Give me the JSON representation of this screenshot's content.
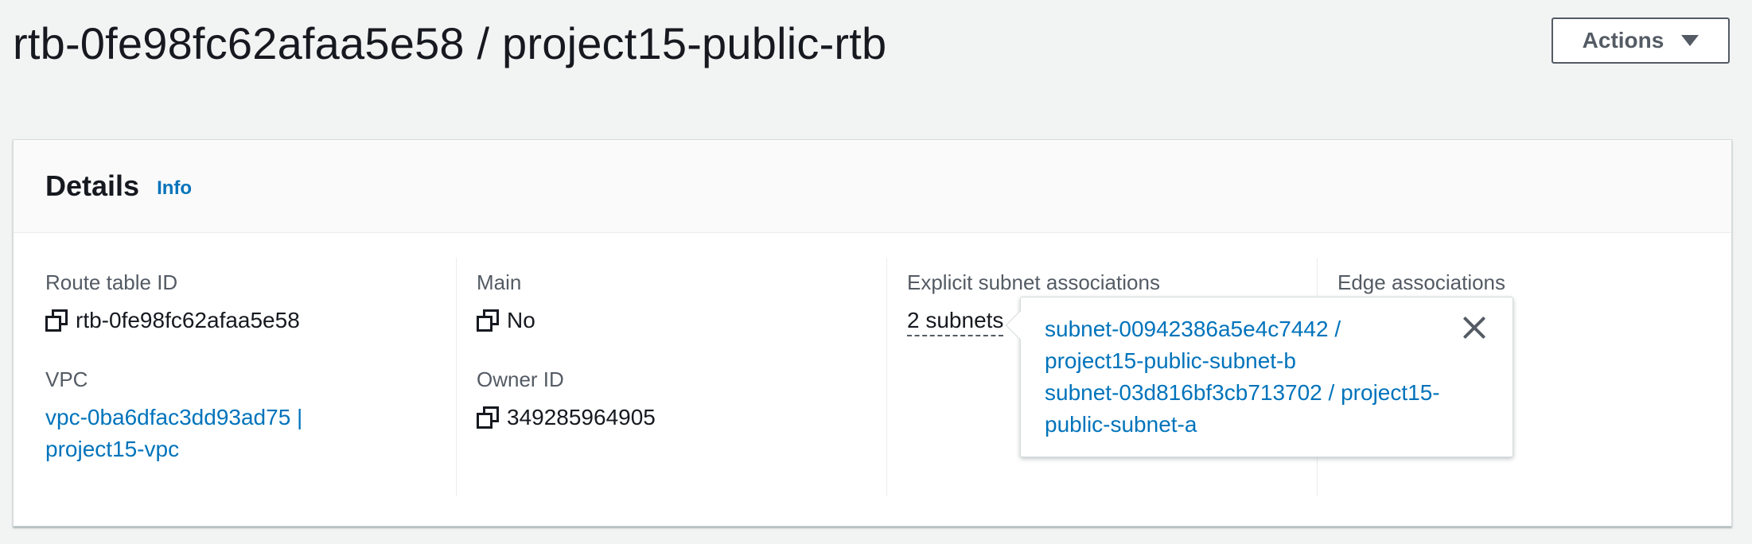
{
  "header": {
    "title": "rtb-0fe98fc62afaa5e58 / project15-public-rtb",
    "actions_label": "Actions"
  },
  "details": {
    "title": "Details",
    "info_label": "Info",
    "route_table_id_label": "Route table ID",
    "route_table_id": "rtb-0fe98fc62afaa5e58",
    "vpc_label": "VPC",
    "vpc_line1": "vpc-0ba6dfac3dd93ad75 |",
    "vpc_line2": "project15-vpc",
    "main_label": "Main",
    "main_value": "No",
    "owner_id_label": "Owner ID",
    "owner_id": "349285964905",
    "explicit_label": "Explicit subnet associations",
    "explicit_value": "2 subnets",
    "edge_label": "Edge associations"
  },
  "popover": {
    "subnets": [
      {
        "line1": "subnet-00942386a5e4c7442 /",
        "line2": "project15-public-subnet-b"
      },
      {
        "line1": "subnet-03d816bf3cb713702 / project15-",
        "line2": "public-subnet-a"
      }
    ]
  }
}
